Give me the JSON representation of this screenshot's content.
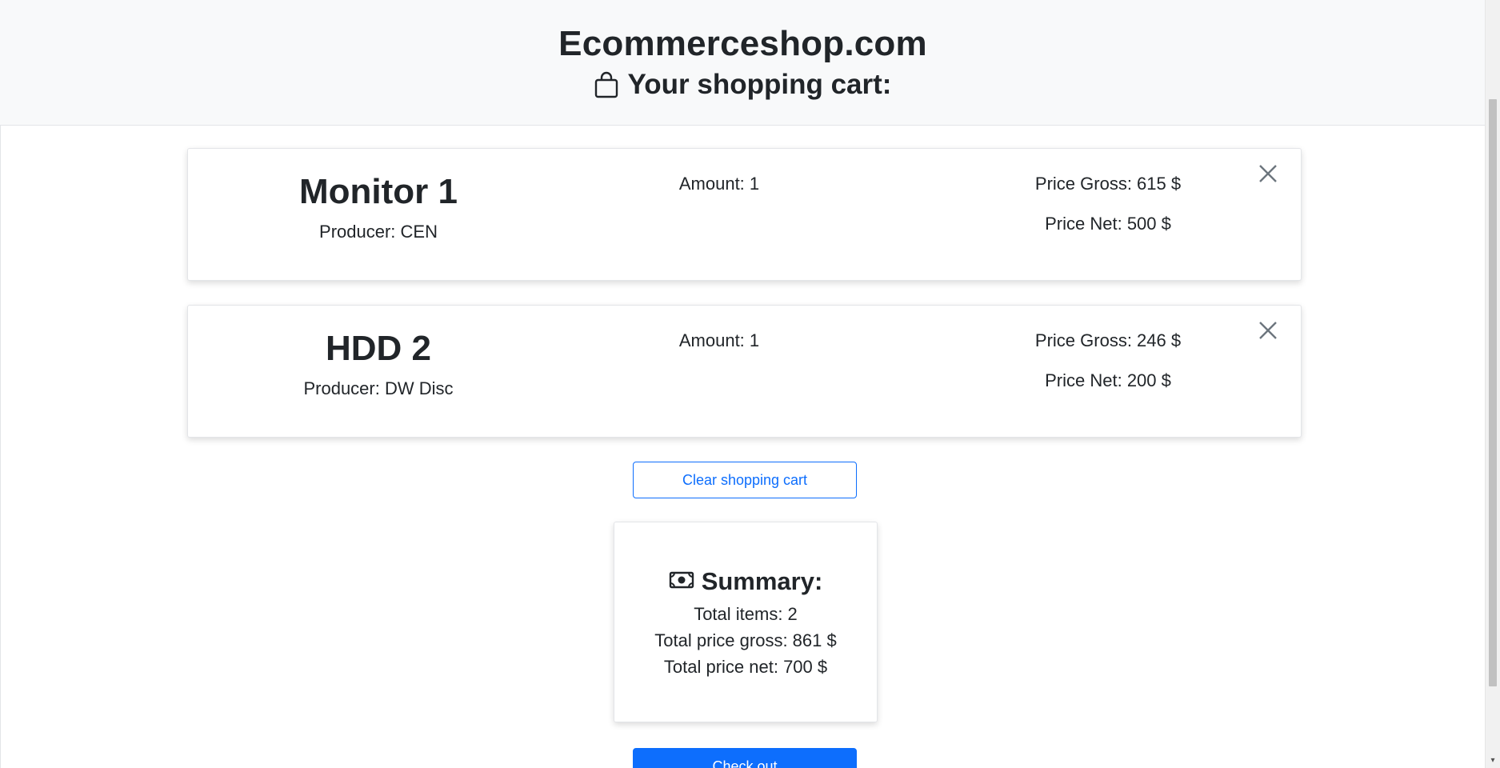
{
  "header": {
    "site_title": "Ecommerceshop.com",
    "cart_heading": "Your shopping cart:",
    "cart_icon": "shopping-bag-icon"
  },
  "cart": {
    "items": [
      {
        "name": "Monitor 1",
        "producer": "Producer: CEN",
        "amount": "Amount: 1",
        "price_gross": "Price Gross: 615 $",
        "price_net": "Price Net: 500 $",
        "remove_icon": "close-icon"
      },
      {
        "name": "HDD 2",
        "producer": "Producer: DW Disc",
        "amount": "Amount: 1",
        "price_gross": "Price Gross: 246 $",
        "price_net": "Price Net: 200 $",
        "remove_icon": "close-icon"
      }
    ],
    "clear_label": "Clear shopping cart"
  },
  "summary": {
    "title": "Summary:",
    "icon": "cash-icon",
    "total_items": "Total items: 2",
    "total_gross": "Total price gross: 861 $",
    "total_net": "Total price net: 700 $"
  },
  "checkout": {
    "label": "Check out"
  },
  "colors": {
    "primary": "#0d6efd",
    "header_bg": "#f8f9fa",
    "text": "#212529"
  }
}
